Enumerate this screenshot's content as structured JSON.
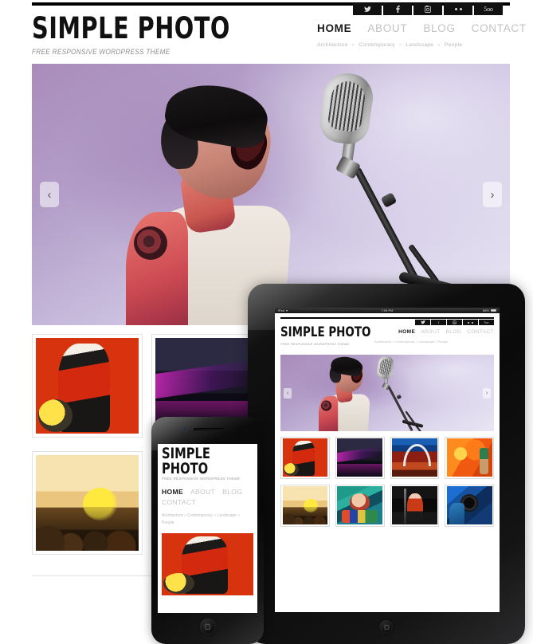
{
  "site": {
    "logo_title": "SIMPLE PHOTO",
    "logo_subtitle": "FREE RESPONSIVE WORDPRESS THEME"
  },
  "social": [
    {
      "name": "twitter-icon",
      "label": ""
    },
    {
      "name": "facebook-icon",
      "label": "f"
    },
    {
      "name": "instagram-icon",
      "label": ""
    },
    {
      "name": "flickr-icon",
      "label": ""
    },
    {
      "name": "500px-icon",
      "label": "5oo"
    }
  ],
  "nav": {
    "items": [
      {
        "label": "HOME",
        "active": true
      },
      {
        "label": "ABOUT",
        "active": false
      },
      {
        "label": "BLOG",
        "active": false
      },
      {
        "label": "CONTACT",
        "active": false
      }
    ],
    "separator": "»",
    "categories": [
      "Architecture",
      "Contemporary",
      "Landscape",
      "People"
    ]
  },
  "slider": {
    "prev_label": "‹",
    "next_label": "›",
    "slide_alt": "Singer shouting into a vintage microphone"
  },
  "gallery": {
    "thumbs": [
      {
        "alt": "Harlequin costume performer with red curtains",
        "style": "ph-harlequin"
      },
      {
        "alt": "Illuminated bridge at night with magenta lights",
        "style": "ph-bridge"
      },
      {
        "alt": "Festival crowd with raised hands in golden light",
        "style": "ph-crowd"
      }
    ]
  },
  "ipad": {
    "status": {
      "carrier": "iPad",
      "wifi": "▾",
      "time": "7:59 PM",
      "battery_percent": "88%"
    },
    "grid": [
      {
        "alt": "Harlequin costume performer",
        "style": "ph-harlequin"
      },
      {
        "alt": "Bridge at night with magenta lights",
        "style": "ph-bridge"
      },
      {
        "alt": "Gateway Arch over red road",
        "style": "ph-arch"
      },
      {
        "alt": "Orange mural with pedestrian",
        "style": "ph-orange"
      },
      {
        "alt": "Festival crowd in golden light",
        "style": "ph-crowd"
      },
      {
        "alt": "Street vendor with colourful stall",
        "style": "ph-teal"
      },
      {
        "alt": "Redhead woman dancing at pole",
        "style": "ph-redhead"
      },
      {
        "alt": "Photographer holding camera",
        "style": "ph-camera"
      }
    ],
    "home_button": "home-button"
  },
  "iphone": {
    "home_button": "home-button",
    "hero_alt": "Harlequin costume performer with red curtains"
  }
}
